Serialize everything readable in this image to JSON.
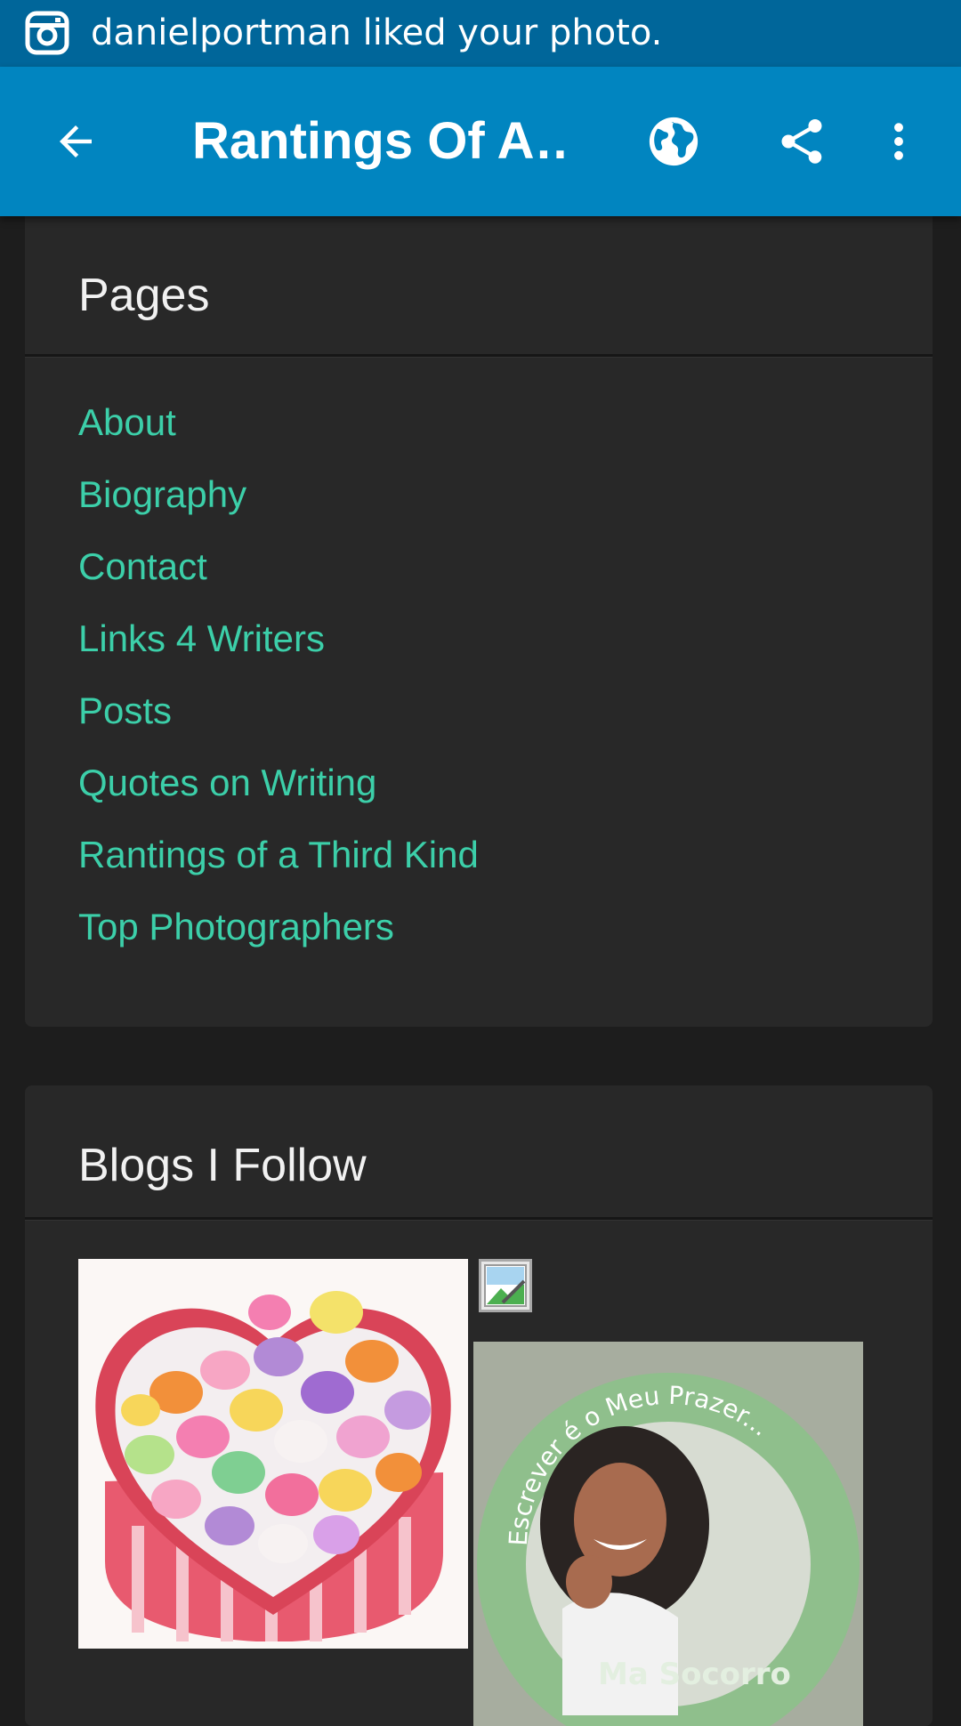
{
  "status_bar": {
    "notification_text": "danielportman liked your photo.",
    "app_icon": "instagram-icon"
  },
  "toolbar": {
    "title": "Rantings Of A…",
    "back_icon": "arrow-back-icon",
    "globe_icon": "globe-icon",
    "share_icon": "share-icon",
    "more_icon": "more-vert-icon",
    "background_color": "#0185c0"
  },
  "pages_widget": {
    "title": "Pages",
    "items": [
      {
        "label": "About"
      },
      {
        "label": "Biography"
      },
      {
        "label": "Contact"
      },
      {
        "label": "Links 4 Writers"
      },
      {
        "label": "Posts"
      },
      {
        "label": "Quotes on Writing"
      },
      {
        "label": "Rantings of a Third Kind"
      },
      {
        "label": "Top Photographers"
      }
    ],
    "link_color": "#3ccfa9"
  },
  "blogs_widget": {
    "title": "Blogs I Follow",
    "thumbs": [
      {
        "name": "candy-hearts-thumbnail"
      },
      {
        "name": "broken-image-icon"
      },
      {
        "name": "escrever-blog-thumbnail",
        "ring_text": "Escrever é o Meu Prazer...",
        "caption": "Ma Socorro"
      }
    ]
  }
}
